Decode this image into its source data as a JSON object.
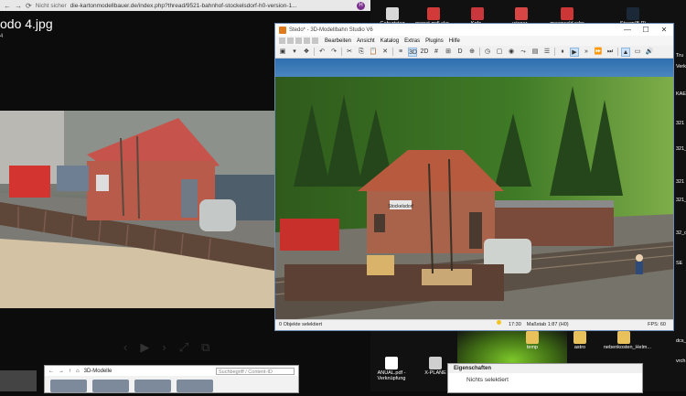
{
  "browser": {
    "secure_label": "Nicht sicher",
    "url": "die-kartonmodellbauer.de/index.php?thread/9521-bahnhof-stockelsdorf-h0-version-1...",
    "avatar_letter": "H",
    "image_title": "odo 4.jpg",
    "image_sub": "4"
  },
  "model_library": {
    "title": "3D-Modelle",
    "search_placeholder": "Suchbegriff / Content-ID"
  },
  "app": {
    "title": "Stedo* - 3D-Modellbahn Studio V6",
    "menu": [
      "Bearbeiten",
      "Ansicht",
      "Katalog",
      "Extras",
      "Plugins",
      "Hilfe"
    ],
    "toolbar_2d3d": {
      "three_d": "3D",
      "two_d": "2D"
    },
    "toolbar_d": "D",
    "status": {
      "selection": "0 Objekte selektiert",
      "time": "17:30",
      "scale": "Maßstab 1:87 (H0)",
      "fps": "FPS: 60"
    },
    "sign_label": "Stockelsdorf"
  },
  "desktop": {
    "icons": [
      {
        "label": "Geburtstag",
        "color": "#d8d8d8"
      },
      {
        "label": "pronet-mdl-sko..",
        "color": "#d23a3a"
      },
      {
        "label": "Kofz - Verknüpfung",
        "color": "#c9373d"
      },
      {
        "label": "wiener - Verknüpfung",
        "color": "#d84545"
      },
      {
        "label": "greenwald rahs sko - Verknüpfung",
        "color": "#cc3636"
      },
      {
        "label": "Steam(B.P)",
        "color": "#1b2838"
      },
      {
        "label": "temp",
        "color": "#e8c15a"
      },
      {
        "label": "astro",
        "color": "#e8c15a"
      },
      {
        "label": "nebenkosten_Helm...",
        "color": "#e8c15a"
      },
      {
        "label": "ANUAL.pdf - Verknüpfung",
        "color": "#ffffff"
      },
      {
        "label": "X-PLANE",
        "color": "#cfcfcf"
      }
    ],
    "edge_labels": [
      "Tru",
      "Verkn",
      "KAE_",
      "321",
      "321_",
      "321",
      "321_",
      "32_c",
      "SE",
      "dcs_",
      "vrch"
    ]
  },
  "properties": {
    "title": "Eigenschaften",
    "text": "Nichts selektiert"
  }
}
